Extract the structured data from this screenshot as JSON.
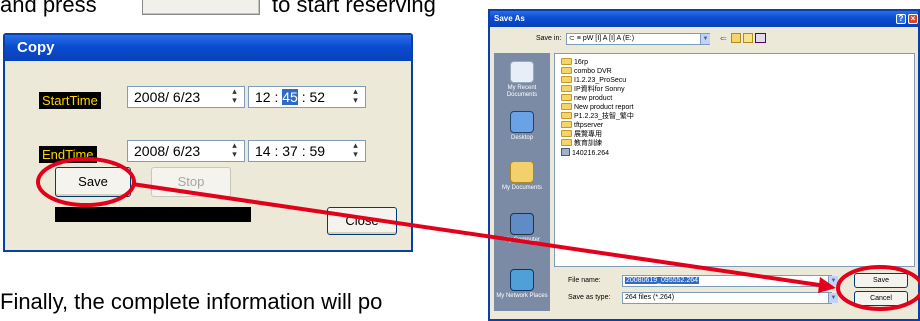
{
  "instructions": {
    "line1_before": "and press",
    "line1_after": "to start reserving",
    "line2": "Finally, the complete information will po"
  },
  "copy_dialog": {
    "title": "Copy",
    "start_label": "StartTime",
    "end_label": "EndTime",
    "start_date": "2008/ 6/23",
    "start_time_hour": "12 :",
    "start_time_minute": "45",
    "start_time_second": ": 52",
    "end_date": "2008/ 6/23",
    "end_time": "14 : 37 : 59",
    "save_label": "Save",
    "stop_label": "Stop",
    "close_label": "Close"
  },
  "save_as": {
    "title": "Save As",
    "save_in_label": "Save in:",
    "save_in_value": "⊂ ≡ pW [Ⅰ] A [Ⅰ] A (E:)",
    "places": [
      {
        "label": "My Recent Documents",
        "icon": "recent-documents-icon"
      },
      {
        "label": "Desktop",
        "icon": "desktop-icon"
      },
      {
        "label": "My Documents",
        "icon": "my-documents-icon"
      },
      {
        "label": "My Computer",
        "icon": "my-computer-icon"
      },
      {
        "label": "My Network Places",
        "icon": "network-places-icon"
      }
    ],
    "files": [
      "16rp",
      "combo DVR",
      "I1.2.23_ProSecu",
      "IP資料for Sonny",
      "new product",
      "New product report",
      "P1.2.23_技智_繁中",
      "tftpserver",
      "展覽專用",
      "教育訓練",
      "140216.264"
    ],
    "file_name_label": "File name:",
    "file_name_value": "20080619_095552.264",
    "save_as_type_label": "Save as type:",
    "save_as_type_value": "264 files (*.264)",
    "save_label": "Save",
    "cancel_label": "Cancel"
  },
  "colors": {
    "annotation_red": "#e3001b",
    "xp_title_blue": "#0a4bd0",
    "dialog_face": "#ece9d8",
    "highlight": "#316ac5"
  }
}
